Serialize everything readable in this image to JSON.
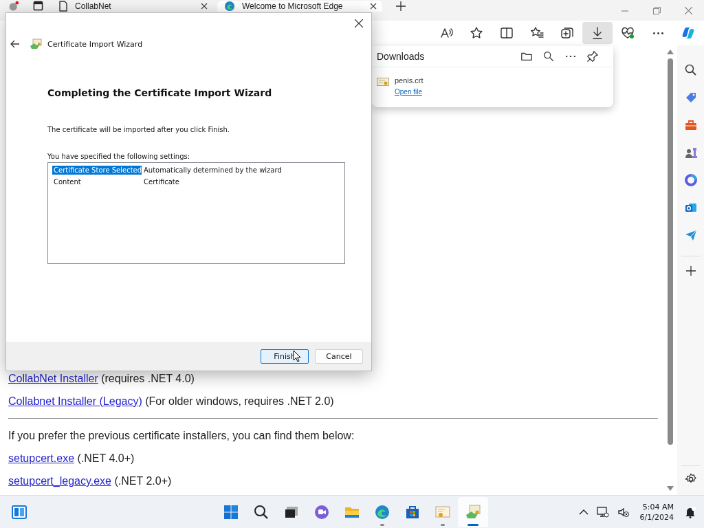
{
  "browser": {
    "tabs": [
      {
        "title": "CollabNet",
        "kind": "document",
        "selected": false
      },
      {
        "title": "Welcome to Microsoft Edge",
        "kind": "edge",
        "selected": true
      }
    ],
    "toolbar": [
      {
        "kind": "read-aloud",
        "selected": false
      },
      {
        "kind": "favorite",
        "selected": false
      },
      {
        "kind": "split",
        "selected": false
      },
      {
        "kind": "favorites",
        "selected": false
      },
      {
        "kind": "collections",
        "selected": false
      },
      {
        "kind": "downloads",
        "selected": true
      },
      {
        "kind": "health",
        "selected": false
      },
      {
        "kind": "more",
        "selected": false
      },
      {
        "kind": "copilot",
        "selected": false
      }
    ]
  },
  "downloads": {
    "title": "Downloads",
    "items": [
      {
        "file": "penis.crt",
        "action": "Open file"
      }
    ]
  },
  "page": {
    "installers": [
      {
        "link": "CollabNet Installer",
        "note": "(requires .NET 4.0)"
      },
      {
        "link": "Collabnet Installer (Legacy)",
        "note": "(For older windows, requires .NET 2.0)"
      }
    ],
    "intro": "If you prefer the previous certificate installers, you can find them below:",
    "legacy": [
      {
        "link": "setupcert.exe",
        "note": "(.NET 4.0+)"
      },
      {
        "link": "setupcert_legacy.exe",
        "note": "(.NET 2.0+)"
      }
    ]
  },
  "wizard": {
    "title": "Certificate Import Wizard",
    "heading": "Completing the Certificate Import Wizard",
    "message": "The certificate will be imported after you click Finish.",
    "settings_label": "You have specified the following settings:",
    "settings": [
      {
        "name": "Certificate Store Selected",
        "value": "Automatically determined by the wizard",
        "selected": true
      },
      {
        "name": "Content",
        "value": "Certificate",
        "selected": false
      }
    ],
    "buttons": [
      {
        "label": "Finish",
        "focused": true
      },
      {
        "label": "Cancel",
        "focused": false
      }
    ]
  },
  "taskbar": {
    "apps": [
      {
        "kind": "start",
        "running": false,
        "selected": false
      },
      {
        "kind": "search",
        "running": false,
        "selected": false
      },
      {
        "kind": "task-view",
        "running": false,
        "selected": false
      },
      {
        "kind": "chat",
        "running": false,
        "selected": false
      },
      {
        "kind": "explorer",
        "running": false,
        "selected": false
      },
      {
        "kind": "edge",
        "running": true,
        "selected": false
      },
      {
        "kind": "store",
        "running": false,
        "selected": false
      },
      {
        "kind": "certificate",
        "running": true,
        "selected": false
      },
      {
        "kind": "wizard",
        "running": true,
        "selected": true
      }
    ],
    "time": "5:04 AM",
    "date": "6/1/2024"
  }
}
